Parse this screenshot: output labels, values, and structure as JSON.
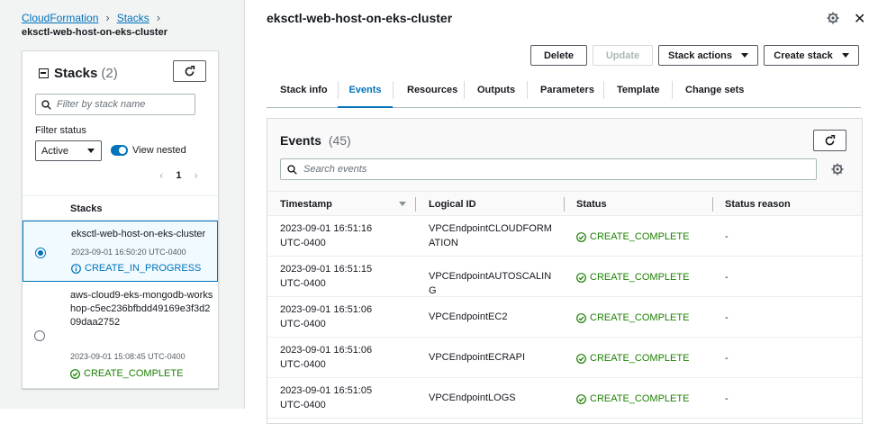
{
  "breadcrumb": {
    "root": "CloudFormation",
    "stacks": "Stacks",
    "current": "eksctl-web-host-on-eks-cluster"
  },
  "stacks_panel": {
    "title": "Stacks",
    "count": "(2)",
    "search_placeholder": "Filter by stack name",
    "filter_label": "Filter status",
    "filter_value": "Active",
    "view_nested_label": "View nested",
    "page": "1",
    "column_header": "Stacks",
    "rows": [
      {
        "name": "eksctl-web-host-on-eks-cluster",
        "date": "2023-09-01 16:50:20 UTC-0400",
        "status": "CREATE_IN_PROGRESS",
        "selected": true
      },
      {
        "name": "aws-cloud9-eks-mongodb-workshop-c5ec236bfbdd49169e3f3d209daa2752",
        "date": "2023-09-01 15:08:45 UTC-0400",
        "status": "CREATE_COMPLETE",
        "selected": false
      }
    ]
  },
  "detail": {
    "title": "eksctl-web-host-on-eks-cluster",
    "buttons": {
      "delete": "Delete",
      "update": "Update",
      "stack_actions": "Stack actions",
      "create_stack": "Create stack"
    },
    "tabs": [
      "Stack info",
      "Events",
      "Resources",
      "Outputs",
      "Parameters",
      "Template",
      "Change sets"
    ],
    "active_tab": "Events"
  },
  "events": {
    "title": "Events",
    "count": "(45)",
    "search_placeholder": "Search events",
    "columns": [
      "Timestamp",
      "Logical ID",
      "Status",
      "Status reason"
    ],
    "rows": [
      {
        "timestamp": "2023-09-01 16:51:16 UTC-0400",
        "logical_id": "VPCEndpointCLOUDFORMATION",
        "status": "CREATE_COMPLETE",
        "reason": "-"
      },
      {
        "timestamp": "2023-09-01 16:51:15 UTC-0400",
        "logical_id": "VPCEndpointAUTOSCALING",
        "status": "CREATE_COMPLETE",
        "reason": "-"
      },
      {
        "timestamp": "2023-09-01 16:51:06 UTC-0400",
        "logical_id": "VPCEndpointEC2",
        "status": "CREATE_COMPLETE",
        "reason": "-"
      },
      {
        "timestamp": "2023-09-01 16:51:06 UTC-0400",
        "logical_id": "VPCEndpointECRAPI",
        "status": "CREATE_COMPLETE",
        "reason": "-"
      },
      {
        "timestamp": "2023-09-01 16:51:05 UTC-0400",
        "logical_id": "VPCEndpointLOGS",
        "status": "CREATE_COMPLETE",
        "reason": "-"
      }
    ]
  },
  "colors": {
    "link": "#0073bb",
    "success": "#1d8102",
    "border": "#d5dbdb"
  }
}
